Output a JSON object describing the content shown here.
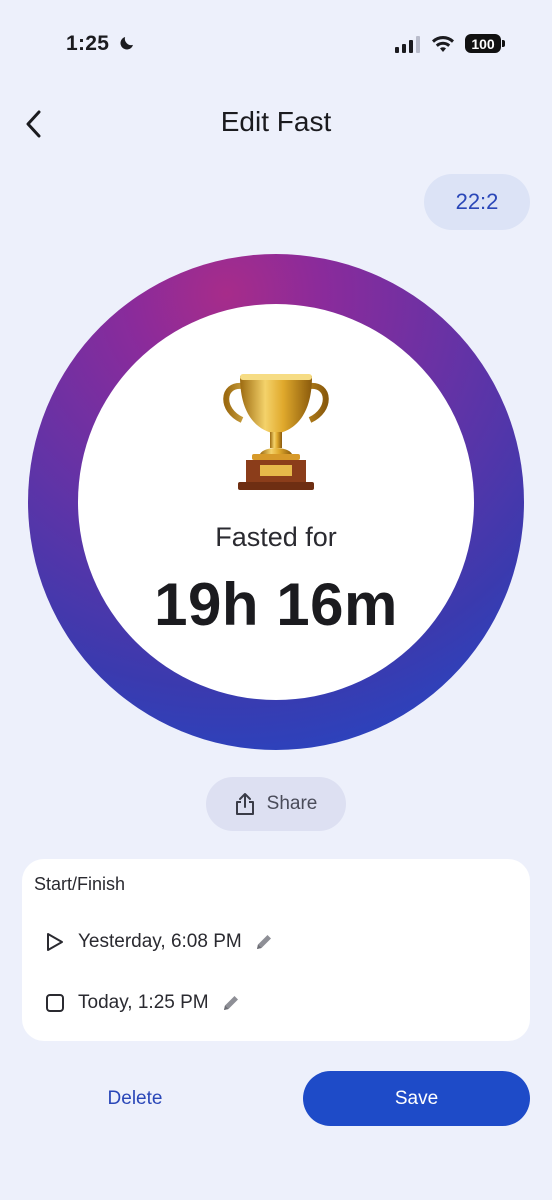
{
  "status_bar": {
    "time": "1:25",
    "battery": "100"
  },
  "header": {
    "title": "Edit Fast"
  },
  "ratio_badge": "22:2",
  "summary": {
    "label": "Fasted for",
    "duration": "19h 16m"
  },
  "share_label": "Share",
  "start_finish": {
    "title": "Start/Finish",
    "start": "Yesterday, 6:08 PM",
    "finish": "Today, 1:25 PM"
  },
  "actions": {
    "delete": "Delete",
    "save": "Save"
  },
  "colors": {
    "accent": "#1E4BC8",
    "background": "#EDF0FB",
    "ring_start": "#A72C8A",
    "ring_end": "#1D4BCB"
  },
  "icons": [
    "moon-icon",
    "cellular-signal-icon",
    "wifi-icon",
    "battery-icon",
    "back-chevron-icon",
    "trophy-icon",
    "share-icon",
    "play-icon",
    "stop-square-icon",
    "pencil-icon"
  ]
}
